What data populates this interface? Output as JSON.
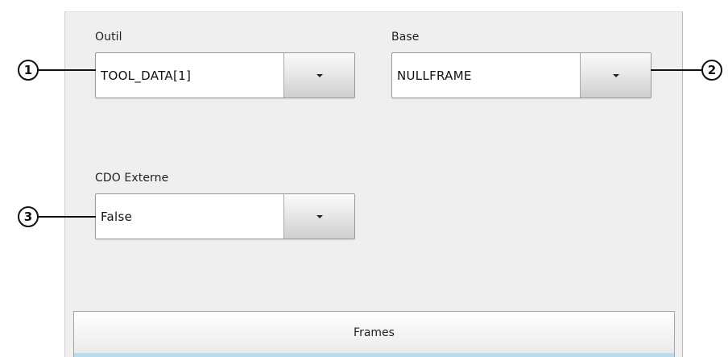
{
  "fields": {
    "outil": {
      "label": "Outil",
      "value": "TOOL_DATA[1]"
    },
    "base": {
      "label": "Base",
      "value": "NULLFRAME"
    },
    "cdo": {
      "label": "CDO Externe",
      "value": "False"
    }
  },
  "callouts": [
    "1",
    "2",
    "3"
  ],
  "tab": {
    "label": "Frames"
  },
  "colors": {
    "panel_bg": "#efefef",
    "tab_accent": "#b9dcec"
  }
}
